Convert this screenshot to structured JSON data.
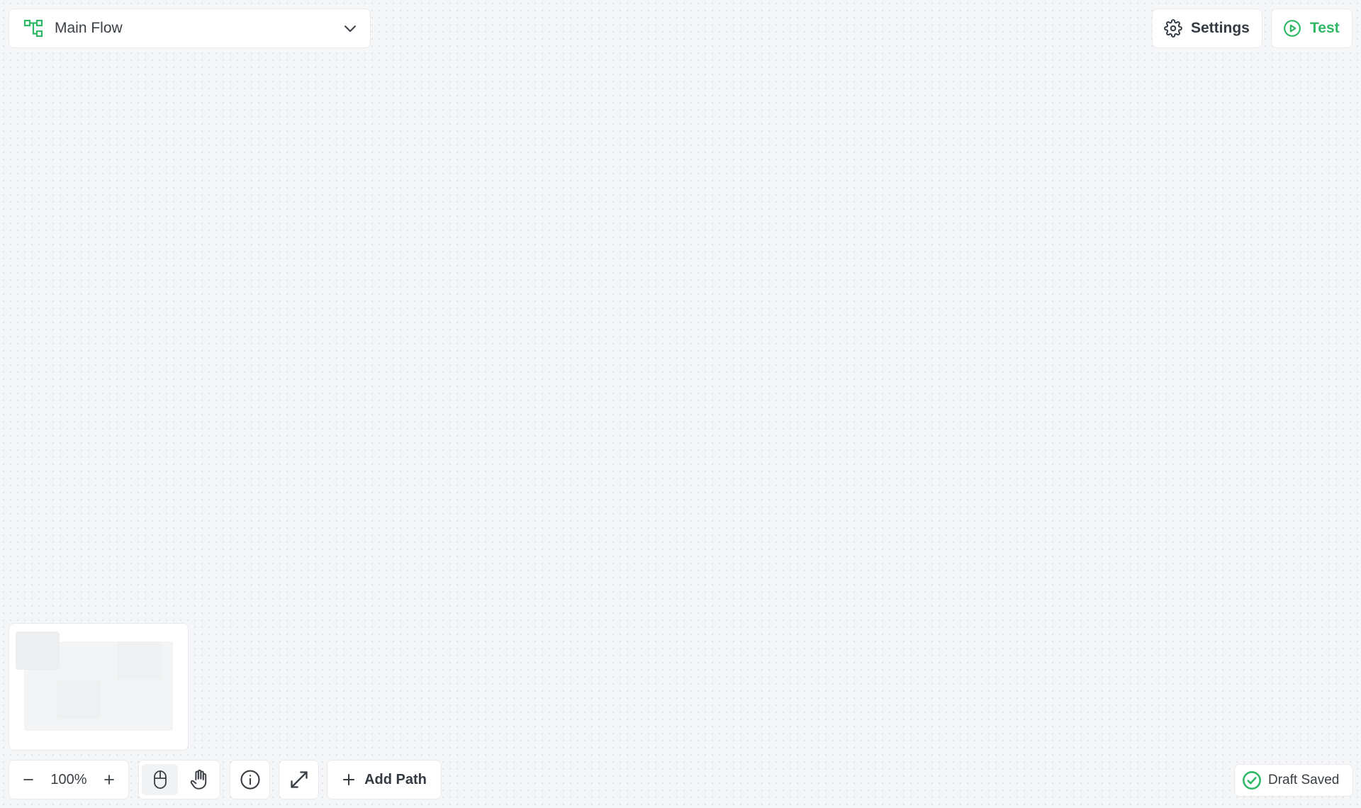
{
  "flow_selector": {
    "icon": "flow-diagram-icon",
    "name": "Main Flow",
    "dropdown_icon": "chevron-down-icon"
  },
  "top_actions": {
    "settings": {
      "label": "Settings",
      "icon": "gear-icon"
    },
    "test": {
      "label": "Test",
      "icon": "play-circle-icon"
    }
  },
  "toolbar": {
    "zoom": {
      "value": "100%",
      "decrease_icon": "minus-icon",
      "increase_icon": "plus-icon"
    },
    "modes": [
      {
        "name": "select",
        "icon": "mouse-icon",
        "active": true
      },
      {
        "name": "pan",
        "icon": "hand-icon",
        "active": false
      }
    ],
    "info_icon": "info-icon",
    "fit_icon": "expand-arrows-icon",
    "add_path": {
      "label": "Add Path",
      "icon": "plus-icon"
    }
  },
  "status": {
    "label": "Draft Saved",
    "icon": "check-circle-icon"
  },
  "colors": {
    "accent_green": "#2fb865",
    "canvas_bg": "#f5f6f7",
    "text_dark": "#333a42"
  }
}
